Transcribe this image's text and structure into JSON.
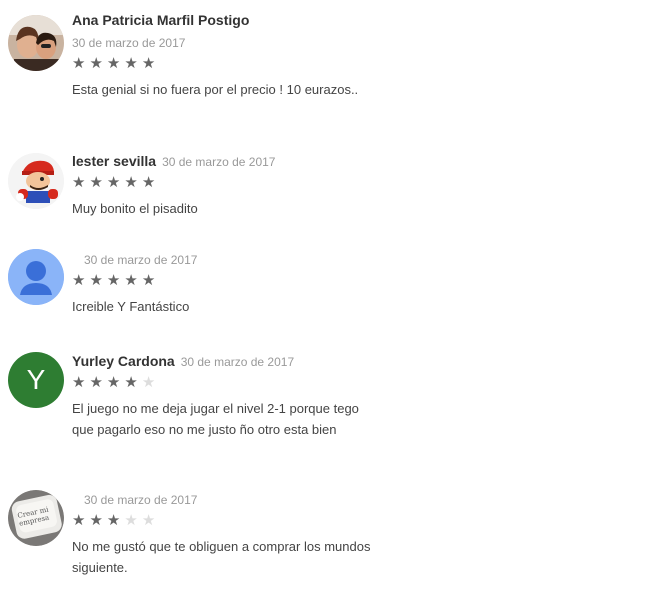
{
  "colors": {
    "star_filled": "#666666",
    "star_empty": "#dddddd",
    "avatar_y_bg": "#2e7d32",
    "avatar_default_bg": "#8ab4f8"
  },
  "reviews": [
    {
      "author": "Ana Patricia Marfil Postigo",
      "date": "30 de marzo de 2017",
      "rating": 5,
      "text": "Esta genial si no fuera por el precio ! 10 eurazos..",
      "avatar_icon": "couple-photo-avatar"
    },
    {
      "author": "lester sevilla",
      "date": "30 de marzo de 2017",
      "rating": 5,
      "text": "Muy bonito el pisadito",
      "avatar_icon": "mario-avatar"
    },
    {
      "author": "",
      "date": "30 de marzo de 2017",
      "rating": 5,
      "text": "Icreible Y Fantástico",
      "avatar_icon": "default-person-avatar"
    },
    {
      "author": "Yurley Cardona",
      "date": "30 de marzo de 2017",
      "rating": 4,
      "text": "El juego no me deja jugar el nivel 2-1 porque tego que pagarlo eso no me justo ño otro esta bien",
      "avatar_letter": "Y"
    },
    {
      "author": "",
      "date": "30 de marzo de 2017",
      "rating": 3,
      "text": "No me gustó que te obliguen a comprar los mundos siguiente.",
      "avatar_icon": "keyboard-key-avatar",
      "avatar_caption": "Crear mi empresa"
    }
  ]
}
